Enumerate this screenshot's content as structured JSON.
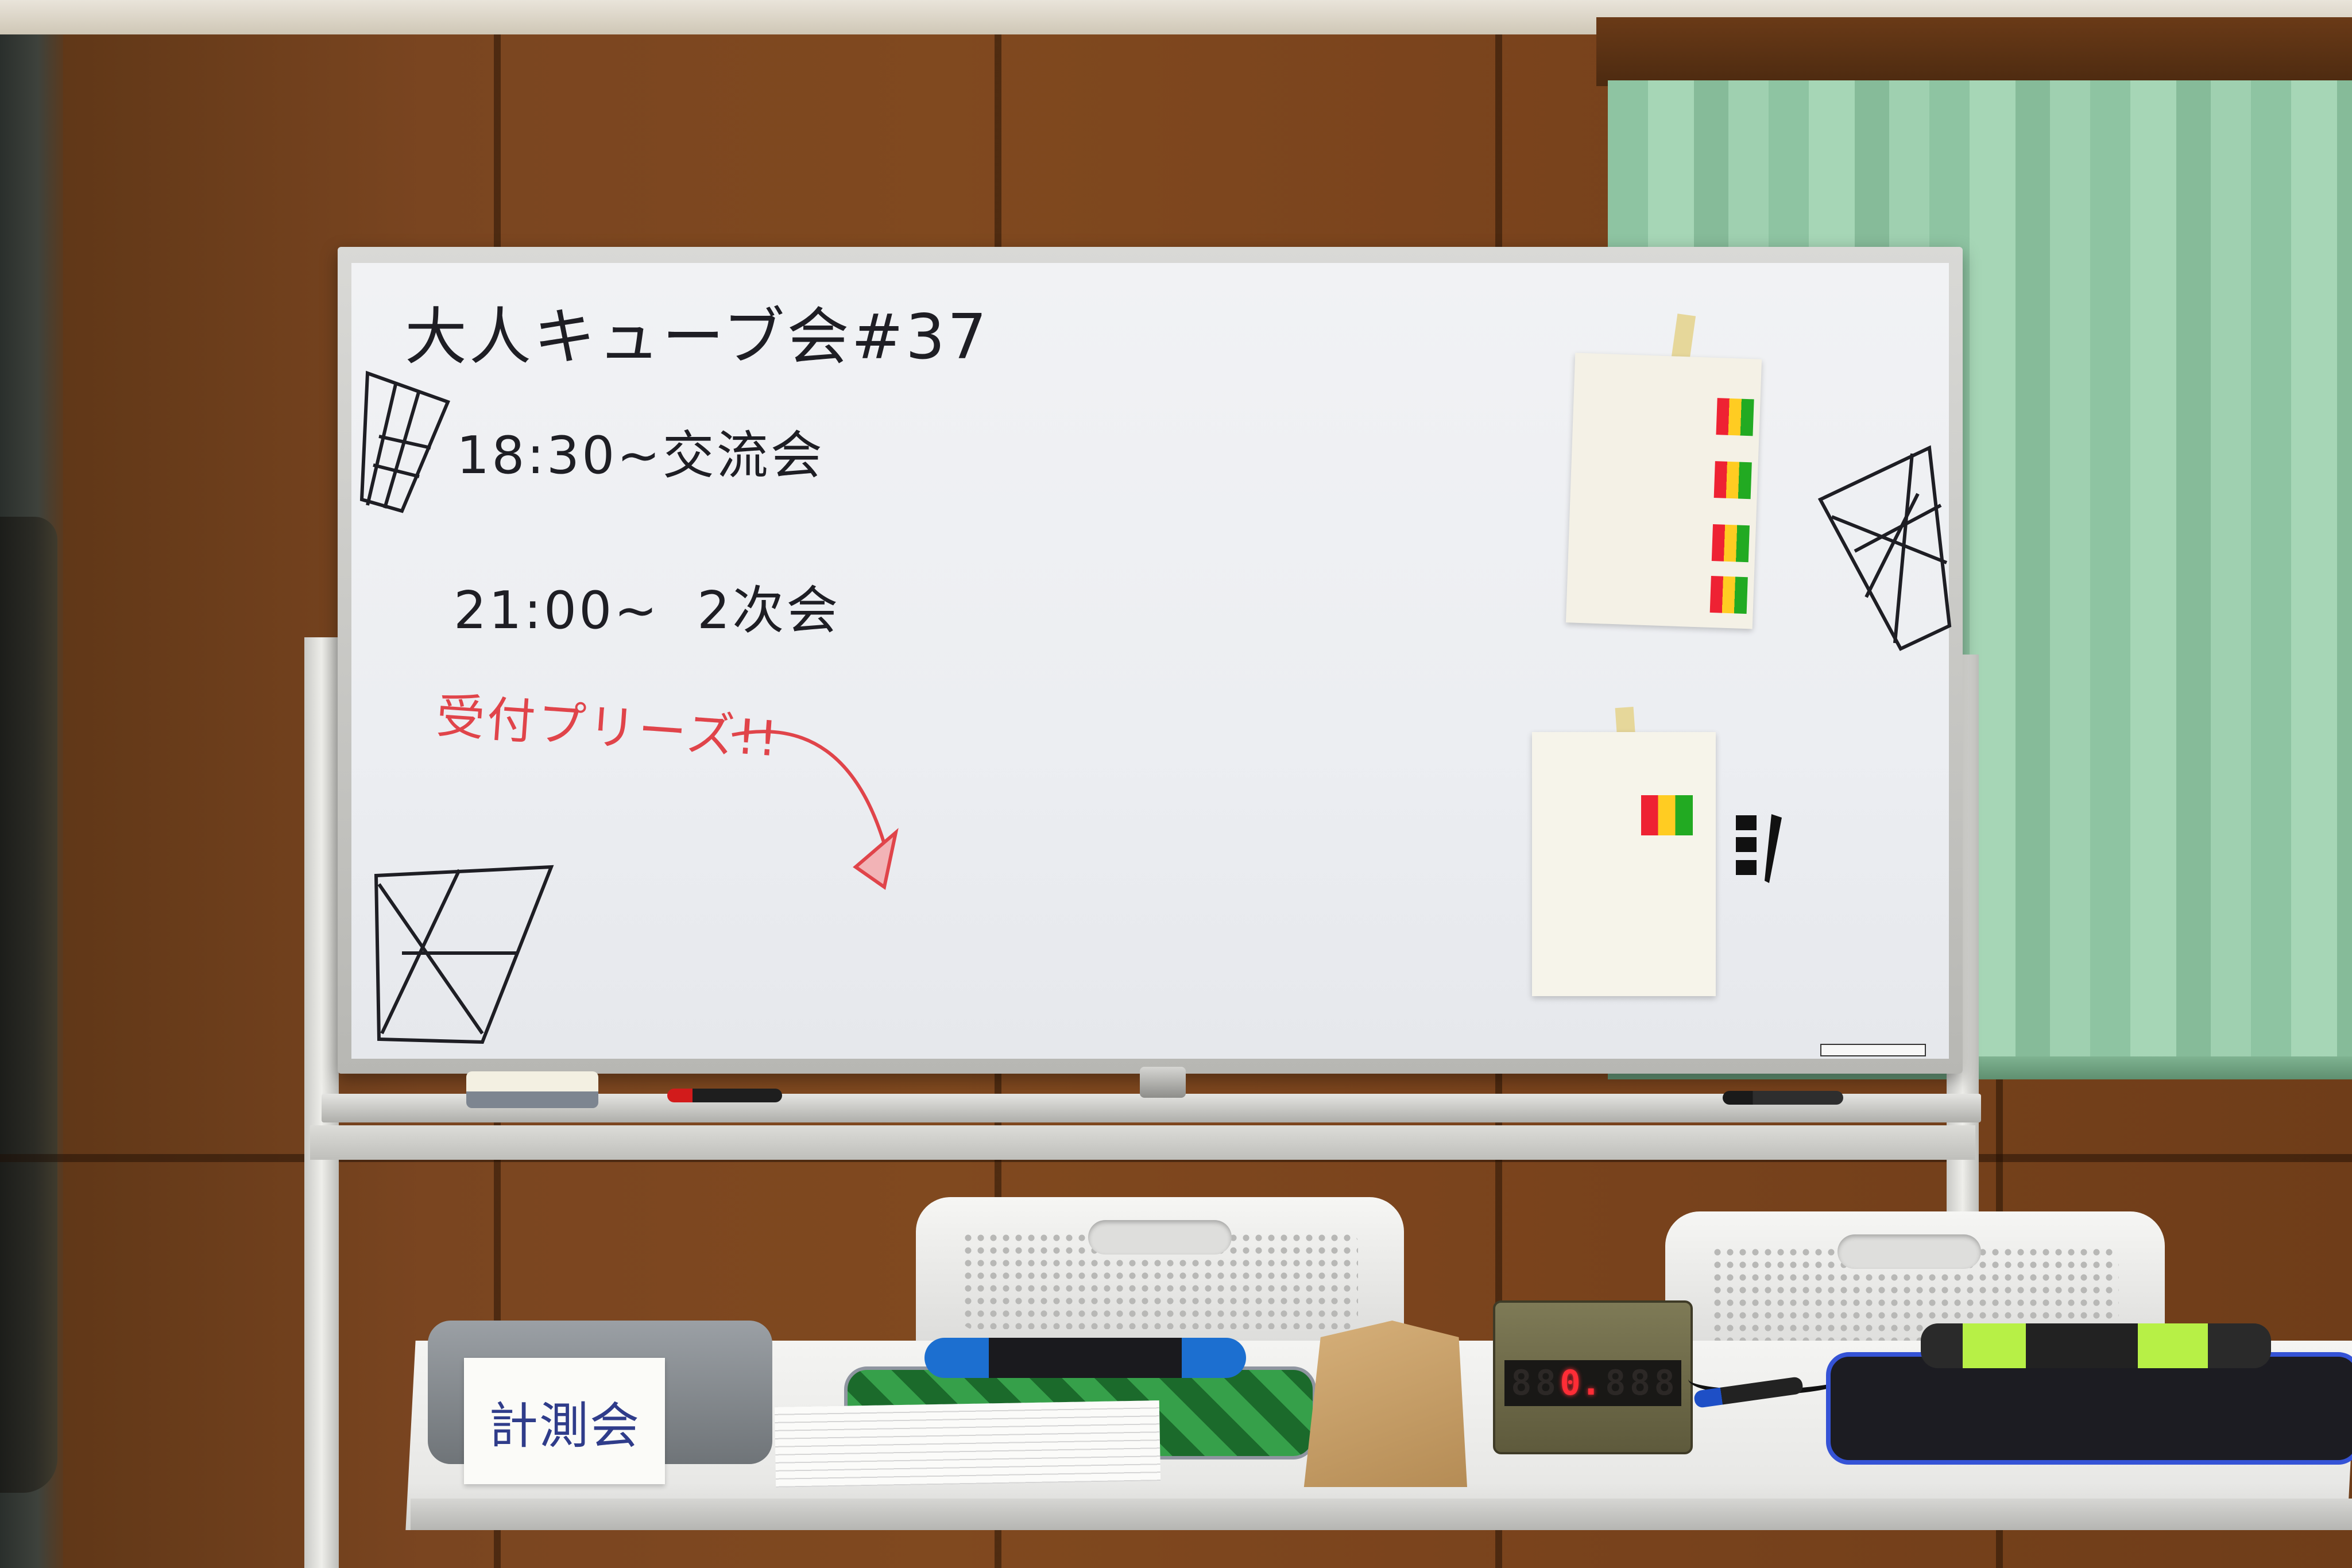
{
  "whiteboard": {
    "title": "大人キューブ会#37",
    "schedule": [
      {
        "time": "18:30~",
        "event": "交流会"
      },
      {
        "time": "21:00~",
        "event": "2次会"
      }
    ],
    "reception_note": "受付プリーズ!!"
  },
  "table": {
    "sign_text": "計測会",
    "timer_display": [
      "8",
      "8",
      "0.",
      "8",
      "8",
      "8"
    ],
    "timer_lit_index": 2
  },
  "colors": {
    "board_ink": "#1e1e24",
    "red_ink": "#e0444a",
    "sign_ink": "#2f3c8a",
    "curtain": "#9fd0b0",
    "wood": "#7a4520",
    "led": "#ff2d36"
  }
}
